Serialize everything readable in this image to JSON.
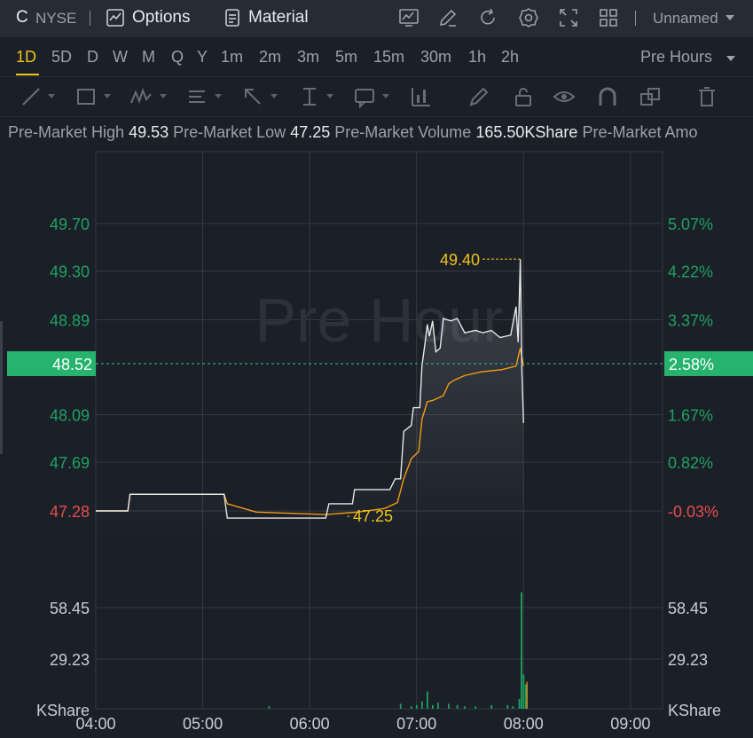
{
  "header": {
    "symbol": "C",
    "exchange": "NYSE",
    "options_label": "Options",
    "material_label": "Material",
    "layout_name": "Unnamed",
    "icons": [
      "chart-settings-icon",
      "pencil-icon",
      "refresh-icon",
      "gear-icon",
      "fullscreen-icon",
      "grid-layout-icon"
    ]
  },
  "periods": [
    "1D",
    "5D",
    "D",
    "W",
    "M",
    "Q",
    "Y",
    "1m",
    "2m",
    "3m",
    "5m",
    "15m",
    "30m",
    "1h",
    "2h"
  ],
  "active_period": "1D",
  "session_select": "Pre Hours",
  "drawing_tools": [
    "line-tool-icon",
    "rectangle-tool-icon",
    "pattern-tool-icon",
    "text-tool-icon",
    "arrow-tool-icon",
    "measure-tool-icon",
    "annotation-tool-icon",
    "indicator-tool-icon",
    "brush-tool-icon",
    "lock-icon",
    "eye-icon",
    "magnet-icon",
    "layers-icon",
    "trash-icon"
  ],
  "info": {
    "high_label": "Pre-Market High",
    "high_value": "49.53",
    "low_label": "Pre-Market Low",
    "low_value": "47.25",
    "volume_label": "Pre-Market Volume",
    "volume_value": "165.50KShare",
    "amount_label": "Pre-Market Amo"
  },
  "chart_data": {
    "type": "line",
    "watermark": "Pre Hour",
    "x_ticks": [
      "04:00",
      "05:00",
      "06:00",
      "07:00",
      "08:00",
      "09:00"
    ],
    "x_range_hours": [
      4,
      9.3
    ],
    "price_ticks": [
      "49.70",
      "49.30",
      "48.89",
      "48.09",
      "47.69",
      "47.28"
    ],
    "price_tick_values": [
      49.7,
      49.3,
      48.89,
      48.09,
      47.69,
      47.28
    ],
    "pct_ticks": [
      "5.07%",
      "4.22%",
      "3.37%",
      "1.67%",
      "0.82%",
      "-0.03%"
    ],
    "current_price": "48.52",
    "current_pct": "2.58%",
    "high_marker": "49.40",
    "low_marker": "47.25",
    "volume_ticks": [
      "58.45",
      "29.23"
    ],
    "volume_unit": "KShare",
    "colors": {
      "up": "#1fa164",
      "down": "#e54d4d",
      "price_line": "#e6e6e6",
      "avg_line": "#f39c12",
      "marker": "#f0c419",
      "current_bg": "#26b36e"
    },
    "series": [
      {
        "name": "price",
        "points": [
          [
            4.0,
            47.28
          ],
          [
            4.3,
            47.28
          ],
          [
            4.32,
            47.42
          ],
          [
            5.2,
            47.42
          ],
          [
            5.23,
            47.22
          ],
          [
            6.15,
            47.22
          ],
          [
            6.18,
            47.34
          ],
          [
            6.4,
            47.34
          ],
          [
            6.42,
            47.46
          ],
          [
            6.75,
            47.46
          ],
          [
            6.8,
            47.55
          ],
          [
            6.85,
            47.55
          ],
          [
            6.88,
            47.95
          ],
          [
            6.95,
            48.0
          ],
          [
            6.97,
            48.15
          ],
          [
            7.03,
            48.15
          ],
          [
            7.05,
            48.5
          ],
          [
            7.08,
            48.7
          ],
          [
            7.1,
            48.85
          ],
          [
            7.12,
            48.75
          ],
          [
            7.15,
            48.88
          ],
          [
            7.18,
            48.62
          ],
          [
            7.22,
            48.65
          ],
          [
            7.25,
            48.9
          ],
          [
            7.32,
            48.88
          ],
          [
            7.38,
            48.9
          ],
          [
            7.45,
            48.78
          ],
          [
            7.55,
            48.8
          ],
          [
            7.62,
            48.78
          ],
          [
            7.7,
            48.8
          ],
          [
            7.78,
            48.74
          ],
          [
            7.88,
            48.76
          ],
          [
            7.93,
            49.0
          ],
          [
            7.95,
            48.7
          ],
          [
            7.97,
            49.4
          ],
          [
            7.985,
            48.45
          ],
          [
            8.0,
            48.02
          ]
        ]
      },
      {
        "name": "average",
        "points": [
          [
            4.0,
            47.28
          ],
          [
            4.3,
            47.28
          ],
          [
            4.32,
            47.42
          ],
          [
            5.2,
            47.42
          ],
          [
            5.23,
            47.34
          ],
          [
            5.5,
            47.27
          ],
          [
            6.15,
            47.25
          ],
          [
            6.45,
            47.27
          ],
          [
            6.7,
            47.3
          ],
          [
            6.82,
            47.35
          ],
          [
            6.88,
            47.55
          ],
          [
            6.95,
            47.72
          ],
          [
            7.02,
            47.78
          ],
          [
            7.05,
            48.05
          ],
          [
            7.1,
            48.2
          ],
          [
            7.15,
            48.21
          ],
          [
            7.25,
            48.25
          ],
          [
            7.3,
            48.35
          ],
          [
            7.35,
            48.38
          ],
          [
            7.45,
            48.42
          ],
          [
            7.6,
            48.45
          ],
          [
            7.8,
            48.47
          ],
          [
            7.93,
            48.5
          ],
          [
            7.97,
            48.65
          ],
          [
            8.0,
            48.5
          ]
        ]
      }
    ],
    "volume": [
      [
        5.62,
        2
      ],
      [
        6.85,
        4
      ],
      [
        6.95,
        2
      ],
      [
        7.0,
        3
      ],
      [
        7.05,
        6
      ],
      [
        7.1,
        14
      ],
      [
        7.15,
        3
      ],
      [
        7.2,
        5
      ],
      [
        7.3,
        4
      ],
      [
        7.38,
        3
      ],
      [
        7.45,
        2
      ],
      [
        7.55,
        2
      ],
      [
        7.7,
        3
      ],
      [
        7.85,
        3
      ],
      [
        7.9,
        2
      ],
      [
        7.96,
        8
      ],
      [
        7.98,
        95
      ],
      [
        8.0,
        28
      ],
      [
        8.02,
        20
      ]
    ]
  }
}
